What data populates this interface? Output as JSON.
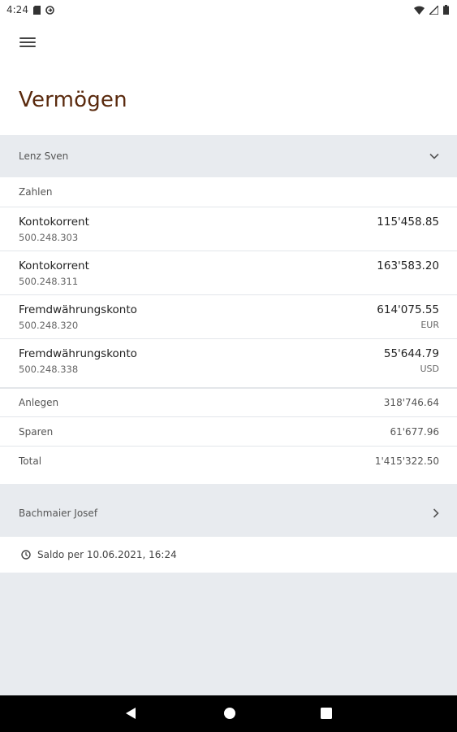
{
  "status": {
    "time": "4:24"
  },
  "header": {
    "title": "Vermögen"
  },
  "owners": [
    {
      "name": "Lenz Sven"
    },
    {
      "name": "Bachmaier Josef"
    }
  ],
  "section": {
    "label": "Zahlen"
  },
  "accounts": [
    {
      "name": "Kontokorrent",
      "number": "500.248.303",
      "amount": "115'458.85",
      "currency": ""
    },
    {
      "name": "Kontokorrent",
      "number": "500.248.311",
      "amount": "163'583.20",
      "currency": ""
    },
    {
      "name": "Fremdwährungskonto",
      "number": "500.248.320",
      "amount": "614'075.55",
      "currency": "EUR"
    },
    {
      "name": "Fremdwährungskonto",
      "number": "500.248.338",
      "amount": "55'644.79",
      "currency": "USD"
    }
  ],
  "summary": [
    {
      "label": "Anlegen",
      "value": "318'746.64"
    },
    {
      "label": "Sparen",
      "value": "61'677.96"
    },
    {
      "label": "Total",
      "value": "1'415'322.50"
    }
  ],
  "saldo": {
    "text": "Saldo per 10.06.2021, 16:24"
  },
  "colors": {
    "title": "#5a2a0e",
    "background": "#e8ebef"
  },
  "icons": [
    "menu-icon",
    "chevron-down-icon",
    "chevron-right-icon",
    "clock-icon",
    "back-icon",
    "home-icon",
    "recents-icon"
  ]
}
